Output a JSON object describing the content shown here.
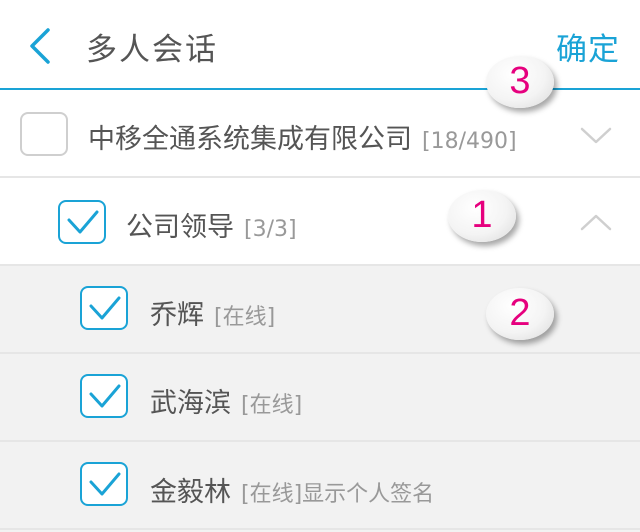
{
  "header": {
    "title": "多人会话",
    "confirm_label": "确定"
  },
  "org": {
    "name": "中移全通系统集成有限公司",
    "count": "[18/490]"
  },
  "group": {
    "name": "公司领导",
    "count": "[3/3]"
  },
  "members": [
    {
      "name": "乔辉",
      "status": "[在线]"
    },
    {
      "name": "武海滨",
      "status": "[在线]"
    },
    {
      "name": "金毅林",
      "status": "[在线]显示个人签名"
    }
  ],
  "annotations": [
    "3",
    "1",
    "2"
  ],
  "colors": {
    "accent": "#1aa3d6",
    "annotation": "#e6007e",
    "member_bg": "#f2f2f2"
  },
  "icons": {
    "back": "chevron-left-icon",
    "expand": "chevron-down-icon",
    "collapse": "chevron-up-icon",
    "check": "checkmark-icon"
  }
}
